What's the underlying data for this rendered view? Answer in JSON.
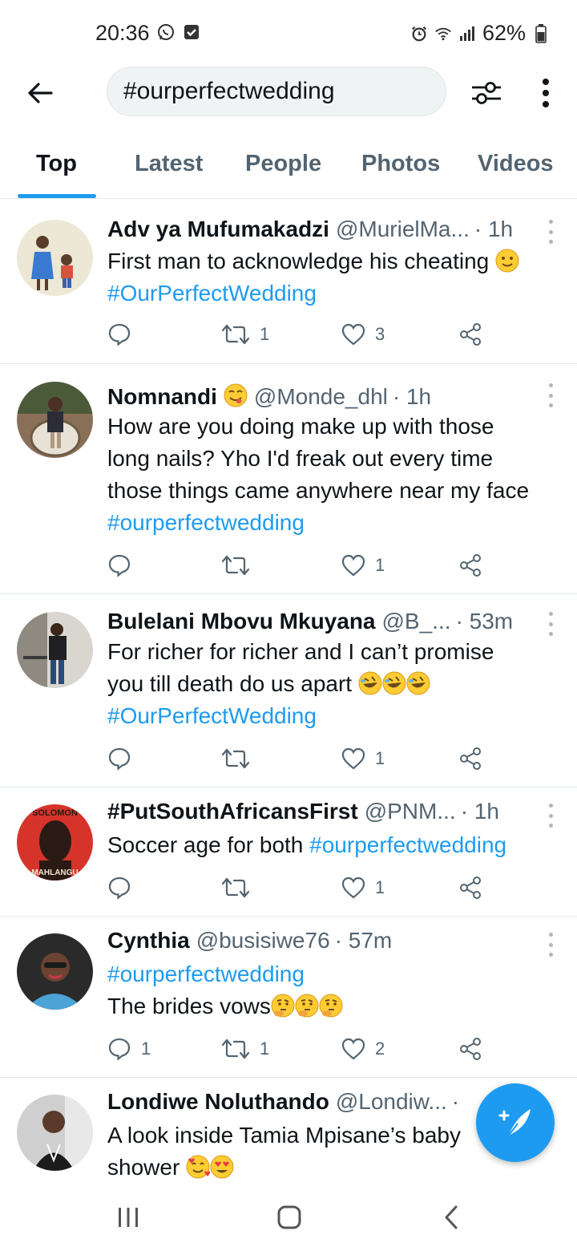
{
  "status_bar": {
    "time": "20:36",
    "battery": "62%",
    "left_icons": [
      "whatsapp-icon",
      "checkbox-icon"
    ],
    "right_icons": [
      "alarm-icon",
      "wifi-icon",
      "signal-icon",
      "battery-icon"
    ]
  },
  "header": {
    "search_value": "#ourperfectwedding",
    "back_icon": "back-arrow-icon",
    "filter_icon": "filter-sliders-icon",
    "more_icon": "vertical-dots-icon"
  },
  "tabs": [
    {
      "label": "Top",
      "active": true
    },
    {
      "label": "Latest",
      "active": false
    },
    {
      "label": "People",
      "active": false
    },
    {
      "label": "Photos",
      "active": false
    },
    {
      "label": "Videos",
      "active": false
    }
  ],
  "tweets": [
    {
      "name": "Adv ya Mufumakadzi",
      "handle": "@MurielMa...",
      "time": "· 1h",
      "lines": [
        {
          "text": "First man to acknowledge his cheating",
          "emoji": "slightly-smiling-face",
          "hashtag": false
        },
        {
          "text": "#OurPerfectWedding",
          "hashtag": true
        }
      ],
      "replies": "",
      "retweets": "1",
      "likes": "3"
    },
    {
      "name": "Nomnandi",
      "name_emoji": "savoring-food-face",
      "handle": "@Monde_dhl",
      "time": "· 1h",
      "lines": [
        {
          "text": "How are you doing make up with those",
          "hashtag": false
        },
        {
          "text": "long nails? Yho I'd freak out every time",
          "hashtag": false
        },
        {
          "text": "those things came anywhere near my face",
          "hashtag": false
        },
        {
          "text": "#ourperfectwedding",
          "hashtag": true
        }
      ],
      "replies": "",
      "retweets": "",
      "likes": "1"
    },
    {
      "name": "Bulelani Mbovu Mkuyana",
      "handle": "@B_...",
      "time": "· 53m",
      "lines": [
        {
          "text": "For richer for richer and I can’t promise",
          "hashtag": false
        },
        {
          "text": "you till death do us apart",
          "emoji": "rolling-on-floor-laughing x3",
          "hashtag": false
        },
        {
          "text": "#OurPerfectWedding",
          "hashtag": true
        }
      ],
      "replies": "",
      "retweets": "",
      "likes": "1"
    },
    {
      "name": "#PutSouthAfricansFirst",
      "handle": "@PNM...",
      "time": "· 1h",
      "avatar_text_top": "SOLOMON",
      "avatar_text_bottom": "MAHLANGU",
      "lines": [
        {
          "text": "Soccer age for both ",
          "hashtag_suffix": "#ourperfectwedding",
          "hashtag": false
        }
      ],
      "replies": "",
      "retweets": "",
      "likes": "1"
    },
    {
      "name": "Cynthia",
      "handle": "@busisiwe76",
      "time": "· 57m",
      "lines": [
        {
          "text": "#ourperfectwedding",
          "hashtag": true
        },
        {
          "text": "The brides vows",
          "emoji": "thinking-face x3",
          "hashtag": false
        }
      ],
      "replies": "1",
      "retweets": "1",
      "likes": "2"
    },
    {
      "name": "Londiwe Noluthando",
      "handle": "@Londiw...",
      "time": "·",
      "lines": [
        {
          "text": "A look inside Tamia Mpisane’s baby",
          "hashtag": false
        },
        {
          "text": "shower",
          "emoji": "smiling-face-with-hearts, heart-eyes",
          "hashtag": false
        }
      ]
    }
  ],
  "fab": {
    "icon": "compose-feather-plus-icon"
  },
  "navbar": {
    "icons": [
      "recent-apps-icon",
      "home-icon",
      "back-chevron-icon"
    ]
  },
  "colors": {
    "accent": "#1d9bf0",
    "text": "#0f1419",
    "secondary_text": "#536471",
    "divider": "#e1e8ed",
    "search_bg": "#eff3f4"
  }
}
